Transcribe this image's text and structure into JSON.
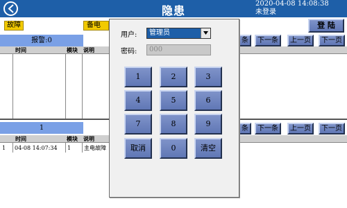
{
  "header": {
    "title": "隐患",
    "datetime": "2020-04-08  14:08:38",
    "login_state": "未登录"
  },
  "tabs": {
    "fault": "故障",
    "backup_power": "备电"
  },
  "toolbar": {
    "login": "登 陆"
  },
  "alarm_panel": {
    "label": "报警:0",
    "columns": [
      "时间",
      "模块",
      "说明"
    ],
    "nav": [
      "下一条",
      "上一页",
      "下一页"
    ],
    "nav_partial": "条"
  },
  "history_panel": {
    "label": "1",
    "columns": [
      "时间",
      "模块",
      "说明"
    ],
    "rows": [
      {
        "index": "1",
        "time": "04-08 14:07:34",
        "module": "1",
        "desc": "主电故障"
      }
    ],
    "nav": [
      "下一条",
      "上一页",
      "下一页"
    ],
    "nav_partial": "条"
  },
  "login_dialog": {
    "user_label": "用户:",
    "user_value": "管理员",
    "password_label": "密码:",
    "password_placeholder": "000",
    "keys": [
      "1",
      "2",
      "3",
      "4",
      "5",
      "6",
      "7",
      "8",
      "9",
      "取消",
      "0",
      "清空"
    ]
  },
  "colors": {
    "header_bg": "#1e5fa8",
    "tab_yellow": "#f2ca00",
    "panel_label": "#7aa0e6",
    "button_face": "#6f85bf"
  }
}
